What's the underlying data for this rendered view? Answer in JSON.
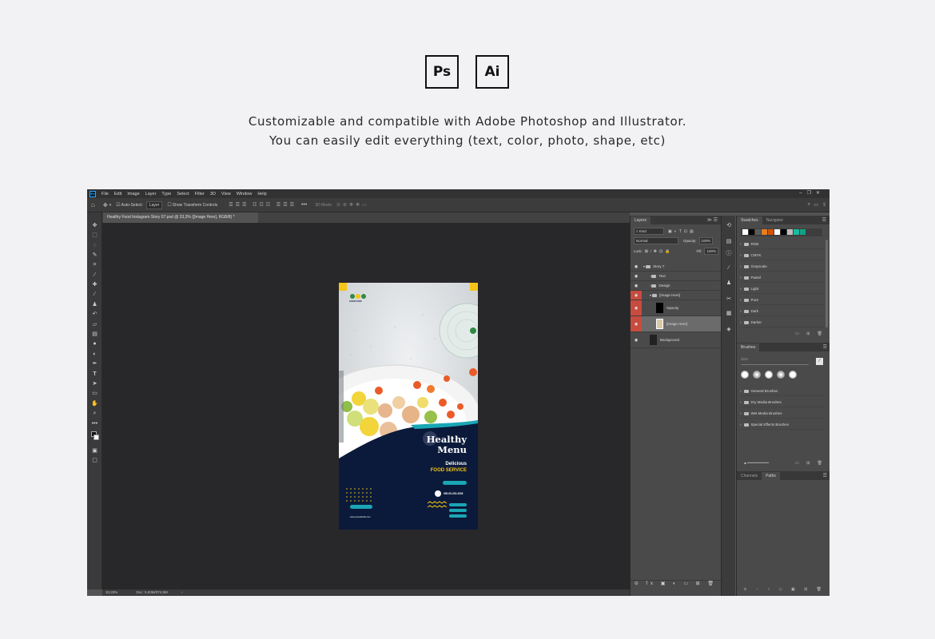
{
  "logos": {
    "ps": "Ps",
    "ai": "Ai"
  },
  "tagline": {
    "line1": "Customizable and compatible with Adobe Photoshop and Illustrator.",
    "line2": "You can easily edit everything (text, color, photo, shape, etc)"
  },
  "app": {
    "logo": "Ps",
    "menu": [
      "File",
      "Edit",
      "Image",
      "Layer",
      "Type",
      "Select",
      "Filter",
      "3D",
      "View",
      "Window",
      "Help"
    ],
    "options": {
      "auto_select": "Auto-Select:",
      "auto_select_value": "Layer",
      "transform": "Show Transform Controls",
      "mode3d": "3D Mode:"
    },
    "document_tab": "Healthy Food Instagram Story 07.psd @ 33,3% ([Image Here], RGB/8) *",
    "status": {
      "zoom": "33,33%",
      "doc": "Doc: 5,93M/374,5M"
    }
  },
  "artwork": {
    "brand": "GOOD FOOD",
    "headline1": "Healthy",
    "headline2": "Menu",
    "sub1": "Delicious",
    "sub2": "FOOD SERVICE",
    "phone": "000-00-222-3333",
    "website": "www.yourwebsite.com",
    "colors": {
      "navy": "#0b1a3a",
      "teal": "#1aa6b5",
      "yellow": "#f5c518"
    }
  },
  "layers_panel": {
    "tab": "Layers",
    "filter": "Kind",
    "blend": "Normal",
    "opacity_label": "Opacity:",
    "opacity_value": "100%",
    "lock_label": "Lock:",
    "fill_label": "Fill:",
    "fill_value": "100%",
    "rows": [
      {
        "name": "Story 7"
      },
      {
        "name": "Text"
      },
      {
        "name": "Design"
      },
      {
        "name": "[Image Here]"
      },
      {
        "name": "Opacity"
      },
      {
        "name": "[Image Here]"
      },
      {
        "name": "Background"
      }
    ]
  },
  "swatches_panel": {
    "tabs": [
      "Swatches",
      "Navigator"
    ],
    "colors": [
      "#ffffff",
      "#000000",
      "#5a5a5a",
      "#e67e22",
      "#d35400",
      "#ffffff",
      "#000000",
      "#bdbdbd",
      "#1abc9c",
      "#16a085"
    ],
    "groups": [
      "RGB",
      "CMYK",
      "Grayscale",
      "Pastel",
      "Light",
      "Pure",
      "Dark",
      "Darker"
    ]
  },
  "brushes_panel": {
    "tab": "Brushes",
    "size_label": "Size:",
    "groups": [
      "General Brushes",
      "Dry Media Brushes",
      "Wet Media Brushes",
      "Special Effects Brushes"
    ]
  },
  "channels_panel": {
    "tabs": [
      "Channels",
      "Paths"
    ]
  }
}
